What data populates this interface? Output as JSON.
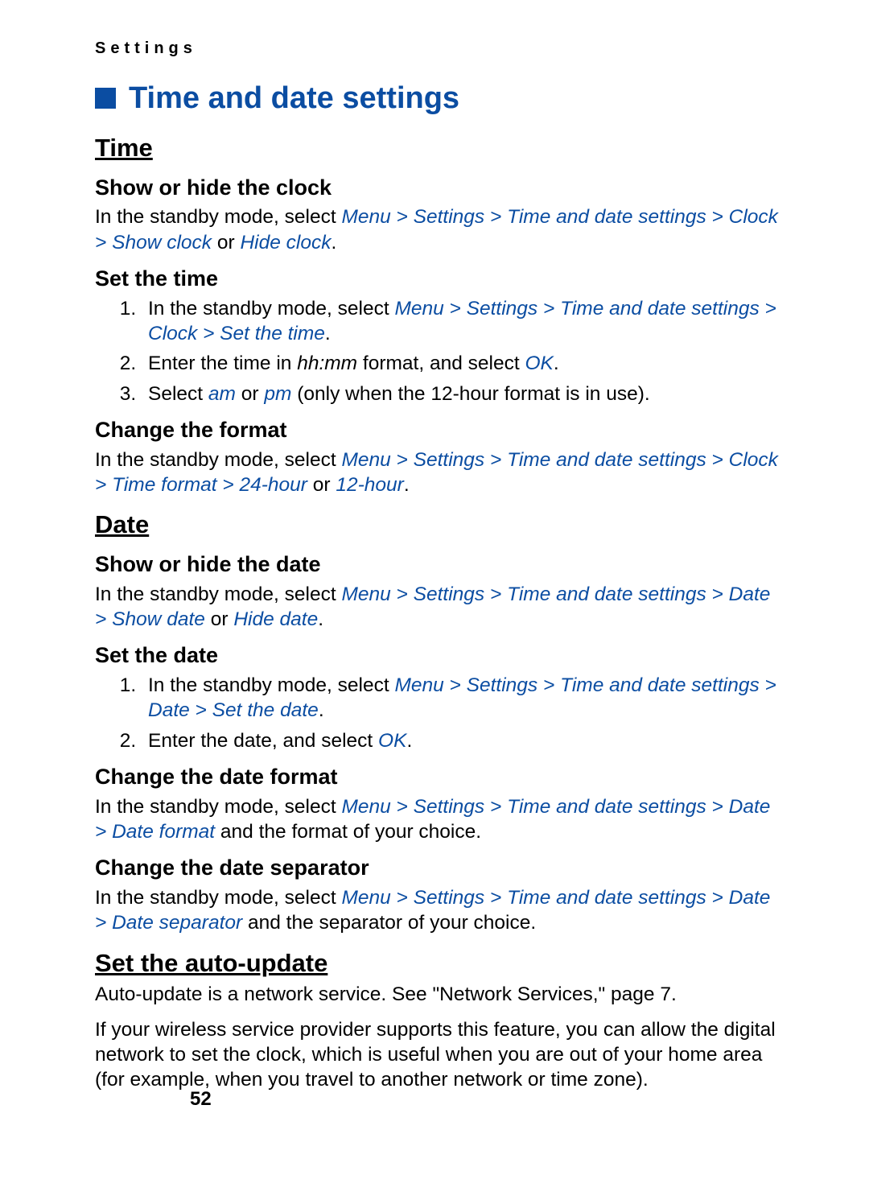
{
  "breadcrumb": "Settings",
  "title": "Time and date settings",
  "page_number": "52",
  "sections": {
    "time": {
      "heading": "Time",
      "show_hide": {
        "heading": "Show or hide the clock",
        "text_prefix": "In the standby mode, select ",
        "path": "Menu > Settings > Time and date settings > Clock > Show clock",
        "or_word": " or ",
        "path_alt": "Hide clock",
        "suffix": "."
      },
      "set_time": {
        "heading": "Set the time",
        "step1_prefix": "In the standby mode, select ",
        "step1_path": "Menu > Settings > Time and date settings > Clock > Set the time",
        "step1_suffix": ".",
        "step2_prefix": "Enter the time in ",
        "step2_italic": "hh:mm",
        "step2_mid": " format, and select ",
        "step2_path": "OK",
        "step2_suffix": ".",
        "step3_prefix": "Select ",
        "step3_path_am": "am",
        "step3_or": " or ",
        "step3_path_pm": "pm",
        "step3_suffix": " (only when the 12-hour format is in use)."
      },
      "change_format": {
        "heading": "Change the format",
        "prefix": "In the standby mode, select ",
        "path": "Menu > Settings > Time and date settings > Clock > Time format > 24-hour",
        "or_word": " or ",
        "path_alt": "12-hour",
        "suffix": "."
      }
    },
    "date": {
      "heading": "Date",
      "show_hide": {
        "heading": "Show or hide the date",
        "prefix": "In the standby mode, select ",
        "path": "Menu > Settings > Time and date settings > Date > Show date",
        "or_word": " or ",
        "path_alt": "Hide date",
        "suffix": "."
      },
      "set_date": {
        "heading": "Set the date",
        "step1_prefix": "In the standby mode, select ",
        "step1_path": "Menu > Settings > Time and date settings > Date > Set the date",
        "step1_suffix": ".",
        "step2_prefix": "Enter the date, and select ",
        "step2_path": "OK",
        "step2_suffix": "."
      },
      "change_format": {
        "heading": "Change the date format",
        "prefix": "In the standby mode, select ",
        "path": "Menu > Settings > Time and date settings > Date > Date format",
        "suffix": " and the format of your choice."
      },
      "change_separator": {
        "heading": "Change the date separator",
        "prefix": "In the standby mode, select ",
        "path": "Menu > Settings > Time and date settings > Date > Date separator",
        "suffix": " and the separator of your choice."
      }
    },
    "auto_update": {
      "heading": "Set the auto-update",
      "para1": "Auto-update is a network service. See \"Network Services,\" page 7.",
      "para2": "If your wireless service provider supports this feature, you can allow the digital network to set the clock, which is useful when you are out of your home area (for example, when you travel to another network or time zone)."
    }
  }
}
